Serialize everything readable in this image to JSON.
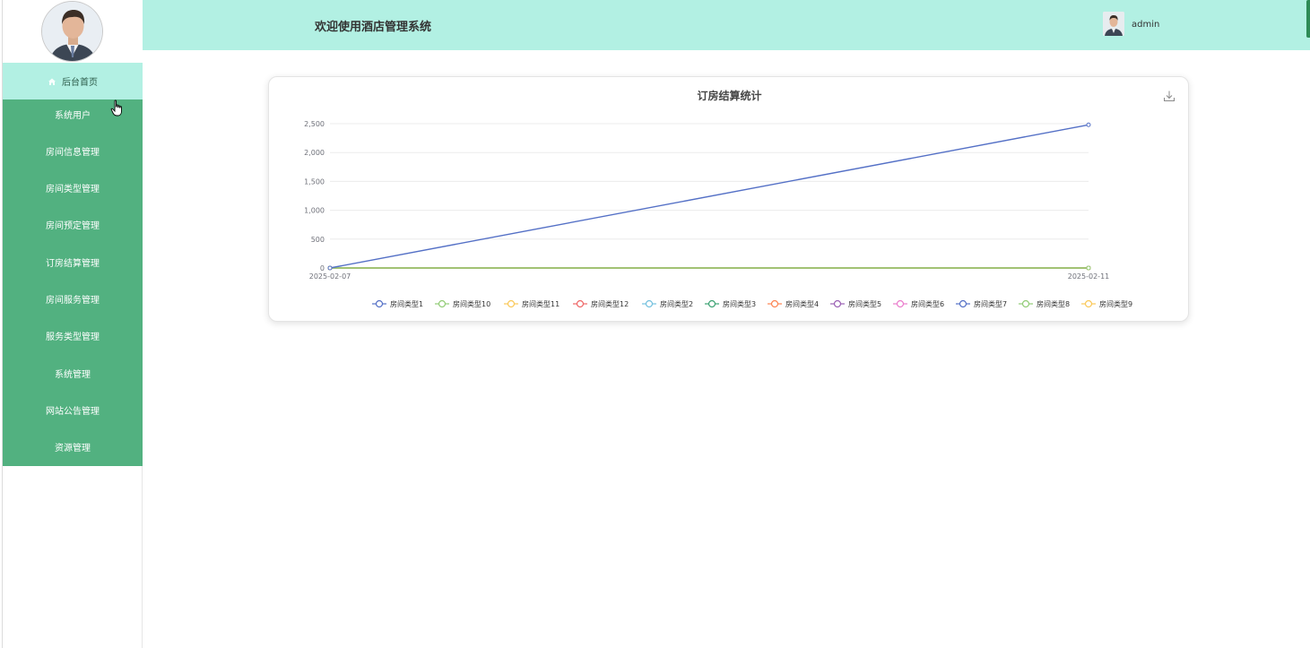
{
  "header": {
    "title": "欢迎使用酒店管理系统",
    "username": "admin",
    "bg_color": "#b2f0e3"
  },
  "sidebar": {
    "menu_color": "#52b180",
    "active_color": "#b2f0e3",
    "items": [
      {
        "label": "后台首页",
        "icon": "home-icon",
        "active": true
      },
      {
        "label": "系统用户"
      },
      {
        "label": "房间信息管理"
      },
      {
        "label": "房间类型管理"
      },
      {
        "label": "房间预定管理"
      },
      {
        "label": "订房结算管理"
      },
      {
        "label": "房间服务管理"
      },
      {
        "label": "服务类型管理"
      },
      {
        "label": "系统管理"
      },
      {
        "label": "网站公告管理"
      },
      {
        "label": "资源管理"
      }
    ]
  },
  "chart_data": {
    "type": "line",
    "title": "订房结算统计",
    "x": [
      "2025-02-07",
      "2025-02-11"
    ],
    "ylim": [
      0,
      2500
    ],
    "yticks": [
      0,
      500,
      1000,
      1500,
      2000,
      2500
    ],
    "ytick_labels": [
      "0",
      "500",
      "1,000",
      "1,500",
      "2,000",
      "2,500"
    ],
    "grid": true,
    "legend_position": "bottom",
    "series": [
      {
        "name": "房间类型1",
        "color": "#5470c6",
        "values": [
          0,
          2480
        ]
      },
      {
        "name": "房间类型10",
        "color": "#91cc75",
        "values": [
          0,
          0
        ]
      },
      {
        "name": "房间类型11",
        "color": "#fac858",
        "values": [
          0,
          0
        ]
      },
      {
        "name": "房间类型12",
        "color": "#ee6666",
        "values": [
          0,
          0
        ]
      },
      {
        "name": "房间类型2",
        "color": "#73c0de",
        "values": [
          0,
          0
        ]
      },
      {
        "name": "房间类型3",
        "color": "#3ba272",
        "values": [
          0,
          0
        ]
      },
      {
        "name": "房间类型4",
        "color": "#fc8452",
        "values": [
          0,
          0
        ]
      },
      {
        "name": "房间类型5",
        "color": "#9a60b4",
        "values": [
          0,
          0
        ]
      },
      {
        "name": "房间类型6",
        "color": "#ea7ccc",
        "values": [
          0,
          0
        ]
      },
      {
        "name": "房间类型7",
        "color": "#5470c6",
        "values": [
          0,
          0
        ]
      },
      {
        "name": "房间类型8",
        "color": "#91cc75",
        "values": [
          0,
          0
        ]
      },
      {
        "name": "房间类型9",
        "color": "#fac858",
        "values": [
          0,
          0
        ]
      }
    ]
  }
}
